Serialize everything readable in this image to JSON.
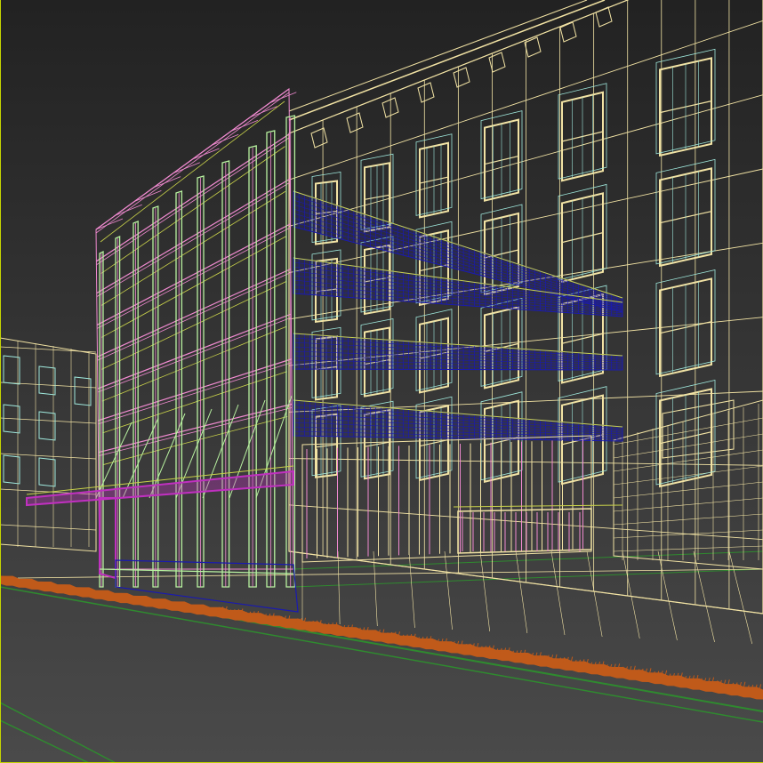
{
  "viewport": {
    "kind": "3D wireframe perspective viewport",
    "shading": "wireframe",
    "active": true
  },
  "colors": {
    "background_top": "#222222",
    "background_bottom": "#4a4a4a",
    "building_wire": "#f2e3a4",
    "window_wire": "#9fe8dc",
    "facade_column_wire": "#b8f2a0",
    "pink_wire": "#f08ad0",
    "magenta_wire": "#c030c0",
    "blue_slab_wire": "#1a1ab0",
    "olive_wire": "#c9d24a",
    "ground_green": "#2f8a2f",
    "grass_orange": "#c05a1a",
    "viewport_border": "#c4d400"
  },
  "scene_objects": [
    {
      "name": "main-building",
      "color_key": "building_wire"
    },
    {
      "name": "facade-frame",
      "color_key": "facade_column_wire"
    },
    {
      "name": "floor-slabs",
      "color_key": "blue_slab_wire"
    },
    {
      "name": "left-building",
      "color_key": "building_wire"
    },
    {
      "name": "right-low-building",
      "color_key": "building_wire"
    },
    {
      "name": "ground-plane",
      "color_key": "ground_green"
    },
    {
      "name": "grass-strip",
      "color_key": "grass_orange"
    }
  ]
}
